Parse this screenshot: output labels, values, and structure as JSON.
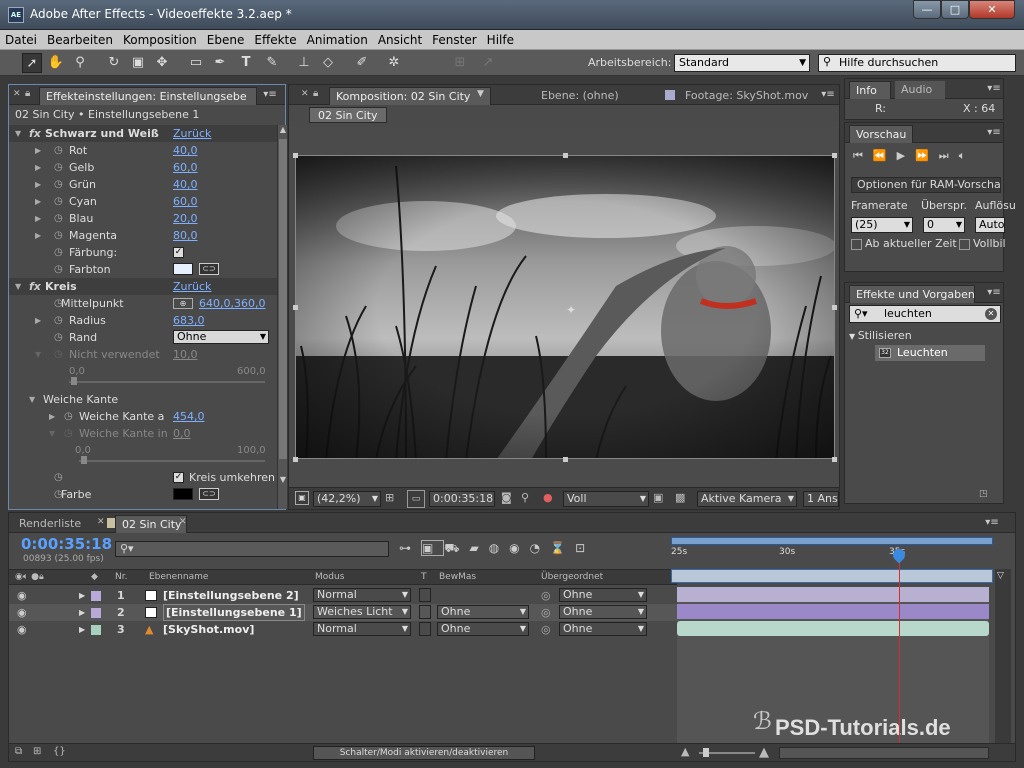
{
  "app": {
    "title": "Adobe After Effects - Videoeffekte 3.2.aep *",
    "icon_text": "AE"
  },
  "window_controls": {
    "minimize": "—",
    "maximize": "□",
    "close": "✕"
  },
  "menu": [
    "Datei",
    "Bearbeiten",
    "Komposition",
    "Ebene",
    "Effekte",
    "Animation",
    "Ansicht",
    "Fenster",
    "Hilfe"
  ],
  "toolbar": {
    "workspace_label": "Arbeitsbereich:",
    "workspace_value": "Standard",
    "help_placeholder": "Hilfe durchsuchen",
    "tool_icons": [
      "selection-icon",
      "hand-icon",
      "zoom-icon",
      "rotate-icon",
      "camera-icon",
      "pan-behind-icon",
      "rectangle-icon",
      "pen-icon",
      "text-icon",
      "brush-icon",
      "clone-stamp-icon",
      "eraser-icon",
      "roto-brush-icon",
      "puppet-pin-icon"
    ]
  },
  "effects_panel": {
    "tab_label": "Effekteinstellungen: Einstellungsebe",
    "breadcrumb": "02 Sin City • Einstellungsebene 1",
    "effect1": {
      "name": "Schwarz und Weiß",
      "reset": "Zurück",
      "params": [
        {
          "label": "Rot",
          "value": "40,0"
        },
        {
          "label": "Gelb",
          "value": "60,0"
        },
        {
          "label": "Grün",
          "value": "40,0"
        },
        {
          "label": "Cyan",
          "value": "60,0"
        },
        {
          "label": "Blau",
          "value": "20,0"
        },
        {
          "label": "Magenta",
          "value": "80,0"
        }
      ],
      "tint_label": "Färbung:",
      "tint_checked": "✓",
      "hue_label": "Farbton",
      "hue_color": "#e8f0ff"
    },
    "effect2": {
      "name": "Kreis",
      "reset": "Zurück",
      "center_label": "Mittelpunkt",
      "center_value": "640,0,360,0",
      "radius_label": "Radius",
      "radius_value": "683,0",
      "edge_label": "Rand",
      "edge_value": "Ohne",
      "unused_label": "Nicht verwendet",
      "unused_value": "10,0",
      "unused_min": "0,0",
      "unused_max": "600,0",
      "soft_edge_group": "Weiche Kante",
      "soft_edge_label": "Weiche Kante a",
      "soft_edge_value": "454,0",
      "soft_edge_in_label": "Weiche Kante in",
      "soft_edge_in_value": "0,0",
      "soft_min": "0,0",
      "soft_max": "100,0",
      "invert_label": "Kreis umkehren",
      "invert_checked": "✓",
      "color_label": "Farbe",
      "color_value": "#000000"
    }
  },
  "comp_panel": {
    "tabs": [
      "Komposition: 02 Sin City",
      "Ebene: (ohne)",
      "Footage: SkyShot.mov"
    ],
    "comp_button": "02 Sin City",
    "zoom": "(42,2%)",
    "timecode": "0:00:35:18",
    "resolution": "Voll",
    "camera": "Aktive Kamera",
    "view": "1 Ans"
  },
  "info_panel": {
    "tabs": [
      "Info",
      "Audio"
    ],
    "r_label": "R:",
    "x_label": "X : 64"
  },
  "preview_panel": {
    "tab": "Vorschau",
    "ram_options": "Optionen für RAM-Vorschau",
    "framerate_label": "Framerate",
    "framerate_value": "(25)",
    "skip_label": "Überspr.",
    "skip_value": "0",
    "resolution_label": "Auflösu",
    "resolution_value": "Auto",
    "from_current": "Ab aktueller Zeit",
    "fullscreen": "Vollbild"
  },
  "effects_presets": {
    "tab": "Effekte und Vorgaben",
    "search_value": "leuchten",
    "category": "Stilisieren",
    "item": "Leuchten"
  },
  "timeline": {
    "tabs": [
      "Renderliste",
      "02 Sin City"
    ],
    "timecode": "0:00:35:18",
    "frames": "00893 (25.00 fps)",
    "columns": {
      "nr": "Nr.",
      "name": "Ebenenname",
      "mode": "Modus",
      "t": "T",
      "trkmat": "BewMas",
      "parent": "Übergeordnet"
    },
    "ruler": [
      "25s",
      "30s",
      "35s"
    ],
    "layers": [
      {
        "nr": "1",
        "name": "[Einstellungsebene 2]",
        "mode": "Normal",
        "trkmat": "",
        "parent": "Ohne",
        "color": "#b9a9d8",
        "bar": "#b8b0d0"
      },
      {
        "nr": "2",
        "name": "[Einstellungsebene 1]",
        "mode": "Weiches Licht",
        "trkmat": "Ohne",
        "parent": "Ohne",
        "color": "#b9a9d8",
        "bar": "#9a88c8"
      },
      {
        "nr": "3",
        "name": "[SkyShot.mov]",
        "mode": "Normal",
        "trkmat": "Ohne",
        "parent": "Ohne",
        "color": "#a8d0c0",
        "bar": "#b8d8cc"
      }
    ],
    "status_button": "Schalter/Modi aktivieren/deaktivieren"
  },
  "watermark": {
    "text": "PSD-Tutorials.de"
  }
}
